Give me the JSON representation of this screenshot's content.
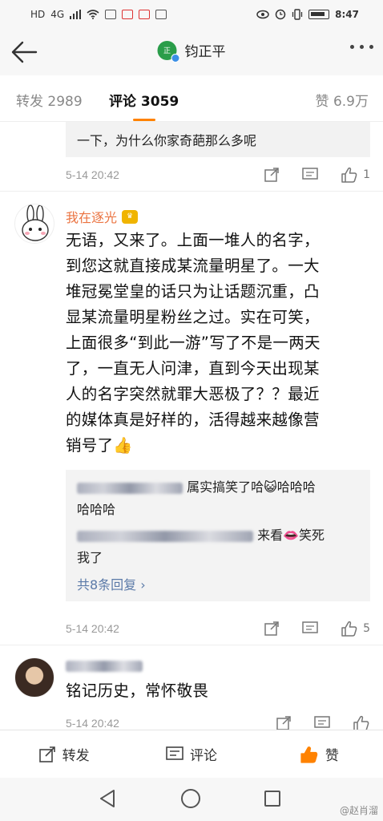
{
  "statusbar": {
    "left_text": "HD",
    "signal": "4G",
    "time": "8:47"
  },
  "header": {
    "title": "钧正平",
    "logo_text": "正",
    "back_icon": "arrow-left-icon",
    "more_icon": "more-dots-icon"
  },
  "tabs": {
    "repost": "转发 2989",
    "comment": "评论 3059",
    "like": "赞 6.9万"
  },
  "previous": {
    "reply_text": "一下，为什么你家奇葩那么多呢",
    "time": "5-14 20:42",
    "like_count": "1"
  },
  "comment1": {
    "username": "我在逐光",
    "text_lines": [
      "无语，又来了。上面一堆人的名字，",
      "到您这就直接成某流量明星了。一大",
      "堆冠冕堂皇的话只为让话题沉重，凸",
      "显某流量明星粉丝之过。实在可笑，",
      "上面很多“到此一游”写了不是一两天",
      "了，一直无人问津，直到今天出现某",
      "人的名字突然就罪大恶极了？？最近",
      "的媒体真是好样的，活得越来越像营",
      "销号了👍"
    ],
    "sub1_text": "属实搞笑了哈😺哈哈哈",
    "sub1_tail": "哈哈哈",
    "sub2_text": "来看👄笑死",
    "sub2_tail": "我了",
    "more_replies": "共8条回复 ›",
    "time": "5-14 20:42",
    "like_count": "5"
  },
  "comment2": {
    "text": "铭记历史，常怀敬畏",
    "time": "5-14 20:42"
  },
  "actionbar": {
    "repost": "转发",
    "comment": "评论",
    "like": "赞"
  },
  "watermark": "@赵肖溜",
  "colors": {
    "accent": "#ff8200",
    "username": "#eb7340",
    "link": "#5b7aa8"
  }
}
